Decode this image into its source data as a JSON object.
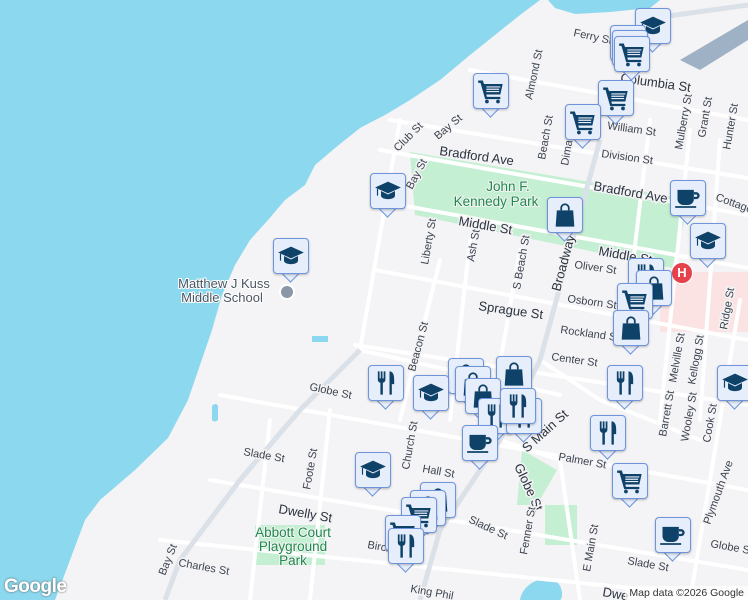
{
  "streets": [
    "Ferry St",
    "Columbia St",
    "Almond St",
    "Club St",
    "Bay St",
    "William St",
    "Bradford Ave",
    "Bradford Ave",
    "Division St",
    "Beach St",
    "Mulberry St",
    "Grant St",
    "Hunter St",
    "Middle St",
    "Middle St",
    "Liberty St",
    "Ash St",
    "S Beach St",
    "Broadway",
    "Oliver St",
    "Osborn St",
    "Sprague St",
    "Rockland St",
    "Center St",
    "Beacon St",
    "Globe St",
    "Church St",
    "Slade St",
    "Foote St",
    "Hall St",
    "Dwelly St",
    "S Main St",
    "Globe St",
    "Palmer St",
    "Fenner St",
    "E Main St",
    "Slade St",
    "Slade St",
    "Charles St",
    "Bay St",
    "Melville St",
    "Kellogg St",
    "Barrett St",
    "Wooley St",
    "Cook St",
    "Plymouth Ave",
    "Globe St",
    "King Phil",
    "Birch",
    "Dwe",
    "Cottage",
    "Ridge St",
    "Dima",
    "Bay St"
  ],
  "parks": {
    "kennedy_line1": "John F.",
    "kennedy_line2": "Kennedy Park",
    "abbott_line1": "Abbott Court",
    "abbott_line2": "Playground",
    "abbott_line3": "Park"
  },
  "school": {
    "line1": "Matthew J Kuss",
    "line2": "Middle School"
  },
  "hospital_label": "H",
  "markers": [
    "education",
    "shopping-cart",
    "shopping-cart",
    "shopping-cart",
    "shopping-cart",
    "shopping-cart",
    "shopping-cart",
    "education",
    "cafe",
    "shopping-bag",
    "education",
    "education",
    "restaurant",
    "shopping-bag",
    "shopping-cart",
    "shopping-bag",
    "restaurant",
    "education",
    "shopping-bag",
    "shopping-bag",
    "shopping-bag",
    "shopping-bag",
    "restaurant",
    "restaurant",
    "restaurant",
    "cafe",
    "restaurant",
    "education",
    "restaurant",
    "shopping-cart",
    "education",
    "shopping-bag",
    "shopping-bag",
    "shopping-cart",
    "shopping-cart",
    "restaurant",
    "cafe"
  ],
  "footer": {
    "logo": "Google",
    "attribution": "Map data ©2026 Google"
  },
  "colors": {
    "water": "#8cd8ee",
    "park": "#c4efd2",
    "land": "#f4f3f5",
    "marker_fill": "#e6edfb",
    "marker_border": "#6e95dc",
    "icon": "#0f4268"
  }
}
